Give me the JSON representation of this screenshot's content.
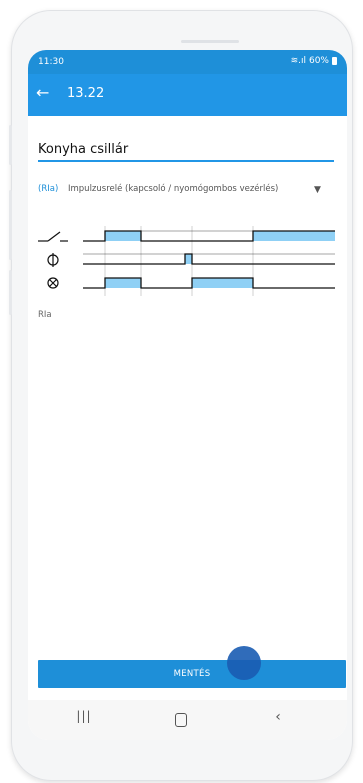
{
  "status_bar": {
    "time": "11:30",
    "battery": "60%"
  },
  "app_bar": {
    "title": "13.22"
  },
  "name_field": {
    "value": "Konyha csillár"
  },
  "mode_select": {
    "code": "(RIa)",
    "label": "Impulzusrelé (kapcsoló / nyomógombos vezérlés)"
  },
  "mode_label": "RIa",
  "save_button": {
    "label": "MENTÉS"
  },
  "colors": {
    "primary": "#2196e6",
    "status": "#1e8fd8",
    "signal_fill": "#8fd0f5",
    "touch": "#1a5cb3"
  },
  "icons": {
    "back": "arrow-left-icon",
    "select": "dropdown-caret-icon",
    "switch": "switch-icon",
    "button": "push-button-icon",
    "lamp": "lamp-icon",
    "nav_recent": "recent-apps-icon",
    "nav_home": "home-icon",
    "nav_back": "back-chevron-icon"
  }
}
